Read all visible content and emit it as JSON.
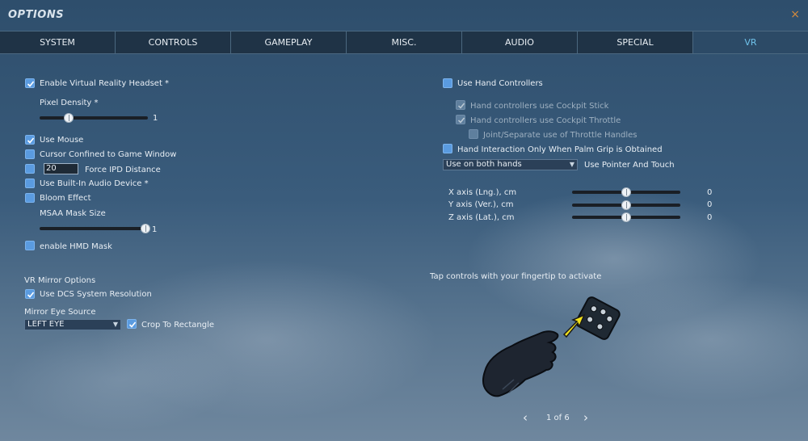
{
  "window": {
    "title": "OPTIONS",
    "close_glyph": "×"
  },
  "tabs": [
    {
      "label": "SYSTEM"
    },
    {
      "label": "CONTROLS"
    },
    {
      "label": "GAMEPLAY"
    },
    {
      "label": "MISC."
    },
    {
      "label": "AUDIO"
    },
    {
      "label": "SPECIAL"
    },
    {
      "label": "VR",
      "active": true
    }
  ],
  "left": {
    "enable_vr": "Enable Virtual Reality Headset *",
    "pixel_density_label": "Pixel Density *",
    "pixel_density_value": "1",
    "use_mouse": "Use Mouse",
    "cursor_confined": "Cursor Confined to Game Window",
    "ipd_value": "20",
    "force_ipd": "Force IPD Distance",
    "builtin_audio": "Use Built-In Audio Device *",
    "bloom": "Bloom Effect",
    "msaa_label": "MSAA Mask Size",
    "msaa_value": "1",
    "hmd_mask": "enable HMD Mask",
    "mirror_heading": "VR Mirror Options",
    "dcs_resolution": "Use DCS System Resolution",
    "mirror_eye_label": "Mirror Eye Source",
    "mirror_eye_value": "LEFT EYE",
    "crop_rect": "Crop To Rectangle"
  },
  "right": {
    "hand_controllers": "Use Hand Controllers",
    "cockpit_stick": "Hand controllers use Cockpit Stick",
    "cockpit_throttle": "Hand controllers use Cockpit Throttle",
    "throttle_handles": "Joint/Separate use of Throttle Handles",
    "palm_grip": "Hand Interaction Only When Palm Grip is Obtained",
    "hands_select": "Use on both hands",
    "pointer_touch": "Use Pointer And Touch",
    "x_axis": "X axis (Lng.), cm",
    "x_value": "0",
    "y_axis": "Y axis (Ver.), cm",
    "y_value": "0",
    "z_axis": "Z axis (Lat.), cm",
    "z_value": "0",
    "tip": "Tap controls with your fingertip to activate",
    "pager": "1 of 6"
  },
  "colors": {
    "accent": "#6fc2ea",
    "checkbox": "#5a9be0",
    "close": "#d58a3c"
  },
  "icons": {
    "prev": "chevron-left-icon",
    "next": "chevron-right-icon",
    "illustration": "glove-tap-controller-icon"
  }
}
